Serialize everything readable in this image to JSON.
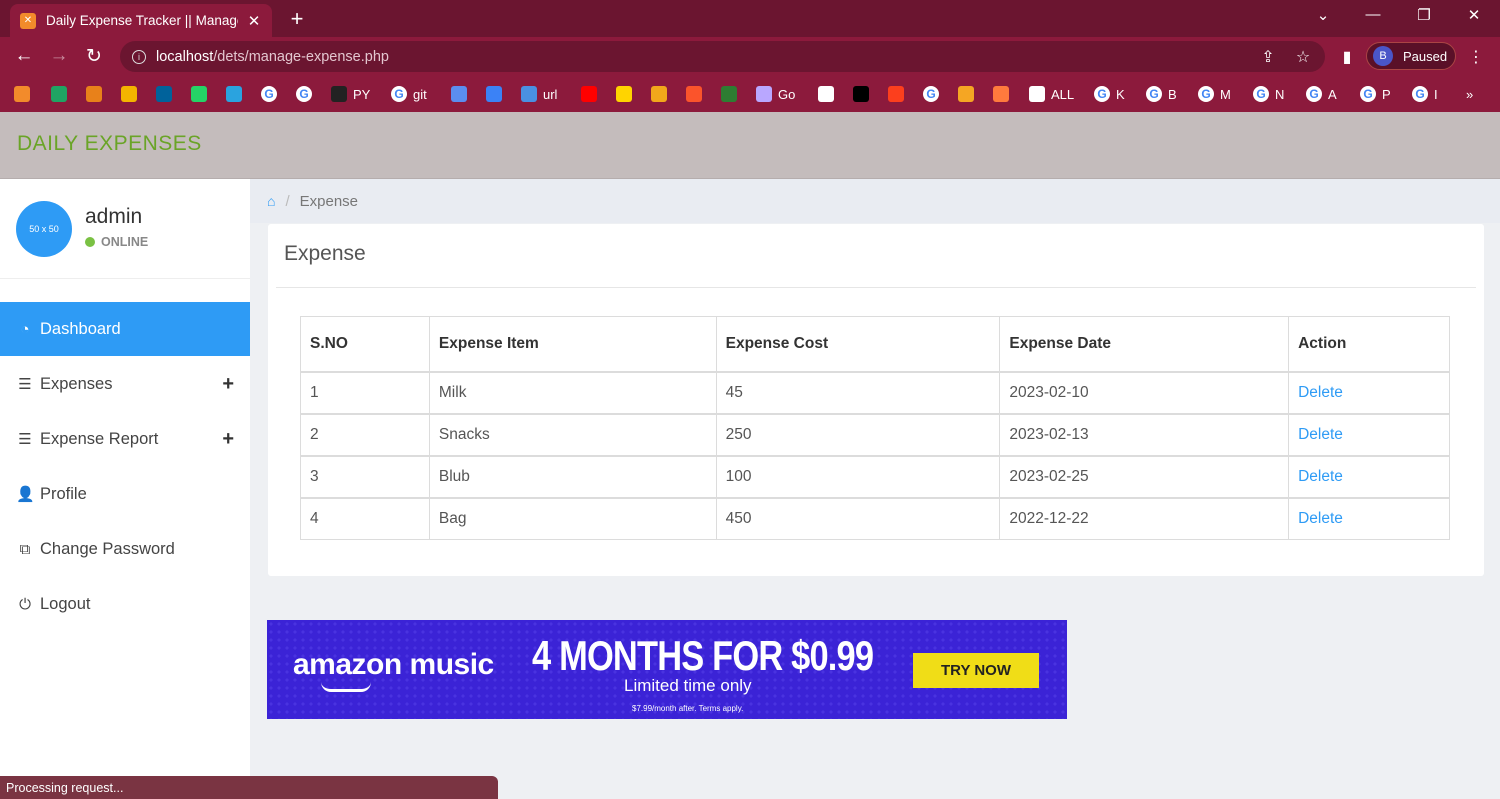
{
  "browser": {
    "tab_title": "Daily Expense Tracker || Manage E",
    "url_host": "localhost",
    "url_path": "/dets/manage-expense.php",
    "profile_initial": "B",
    "profile_status": "Paused",
    "bookmarks": [
      {
        "label": "",
        "icon": "icon-orange"
      },
      {
        "label": "",
        "icon": "icon-sheets"
      },
      {
        "label": "",
        "icon": "icon-orange2"
      },
      {
        "label": "",
        "icon": "icon-chart"
      },
      {
        "label": "",
        "icon": "icon-ieee"
      },
      {
        "label": "",
        "icon": "icon-whatsapp"
      },
      {
        "label": "",
        "icon": "icon-telegram"
      },
      {
        "label": "",
        "icon": "icon-google"
      },
      {
        "label": "",
        "icon": "icon-google"
      },
      {
        "label": "PY",
        "icon": "icon-github"
      },
      {
        "label": "git",
        "icon": "icon-google"
      },
      {
        "label": "",
        "icon": "icon-blue"
      },
      {
        "label": "",
        "icon": "icon-store"
      },
      {
        "label": "url",
        "icon": "icon-wifi"
      },
      {
        "label": "",
        "icon": "icon-youtube"
      },
      {
        "label": "",
        "icon": "icon-p"
      },
      {
        "label": "",
        "icon": "icon-video"
      },
      {
        "label": "",
        "icon": "icon-brave"
      },
      {
        "label": "",
        "icon": "icon-ring"
      },
      {
        "label": "Go",
        "icon": "icon-go"
      },
      {
        "label": "",
        "icon": "icon-doc"
      },
      {
        "label": "",
        "icon": "icon-cl"
      },
      {
        "label": "",
        "icon": "icon-yandex"
      },
      {
        "label": "",
        "icon": "icon-google"
      },
      {
        "label": "",
        "icon": "icon-arrow"
      },
      {
        "label": "",
        "icon": "icon-fish"
      },
      {
        "label": "ALL",
        "icon": "icon-globe"
      },
      {
        "label": "K",
        "icon": "icon-google"
      },
      {
        "label": "B",
        "icon": "icon-google"
      },
      {
        "label": "M",
        "icon": "icon-google"
      },
      {
        "label": "N",
        "icon": "icon-google"
      },
      {
        "label": "A",
        "icon": "icon-google"
      },
      {
        "label": "P",
        "icon": "icon-google"
      },
      {
        "label": "I",
        "icon": "icon-google"
      }
    ],
    "status_text": "Processing request..."
  },
  "app": {
    "brand": "DAILY EXPENSES",
    "brand_color": "#6aa427",
    "accent_color": "#2e9bf5"
  },
  "user": {
    "avatar_text": "50 x 50",
    "name": "admin",
    "status": "ONLINE"
  },
  "menu": [
    {
      "label": "Dashboard",
      "icon": "dashboard-icon",
      "active": true,
      "expandable": false
    },
    {
      "label": "Expenses",
      "icon": "list-icon",
      "active": false,
      "expandable": true
    },
    {
      "label": "Expense Report",
      "icon": "list-icon",
      "active": false,
      "expandable": true
    },
    {
      "label": "Profile",
      "icon": "user-icon",
      "active": false,
      "expandable": false
    },
    {
      "label": "Change Password",
      "icon": "copy-icon",
      "active": false,
      "expandable": false
    },
    {
      "label": "Logout",
      "icon": "power-icon",
      "active": false,
      "expandable": false
    }
  ],
  "breadcrumb": {
    "current": "Expense"
  },
  "panel": {
    "title": "Expense",
    "columns": [
      "S.NO",
      "Expense Item",
      "Expense Cost",
      "Expense Date",
      "Action"
    ],
    "rows": [
      {
        "sno": "1",
        "item": "Milk",
        "cost": "45",
        "date": "2023-02-10",
        "action": "Delete"
      },
      {
        "sno": "2",
        "item": "Snacks",
        "cost": "250",
        "date": "2023-02-13",
        "action": "Delete"
      },
      {
        "sno": "3",
        "item": "Blub",
        "cost": "100",
        "date": "2023-02-25",
        "action": "Delete"
      },
      {
        "sno": "4",
        "item": "Bag",
        "cost": "450",
        "date": "2022-12-22",
        "action": "Delete"
      }
    ]
  },
  "ad": {
    "brand": "amazon music",
    "headline": "4 MONTHS FOR $0.99",
    "subline": "Limited time only",
    "fineprint": "$7.99/month after. Terms apply.",
    "button": "TRY NOW"
  }
}
